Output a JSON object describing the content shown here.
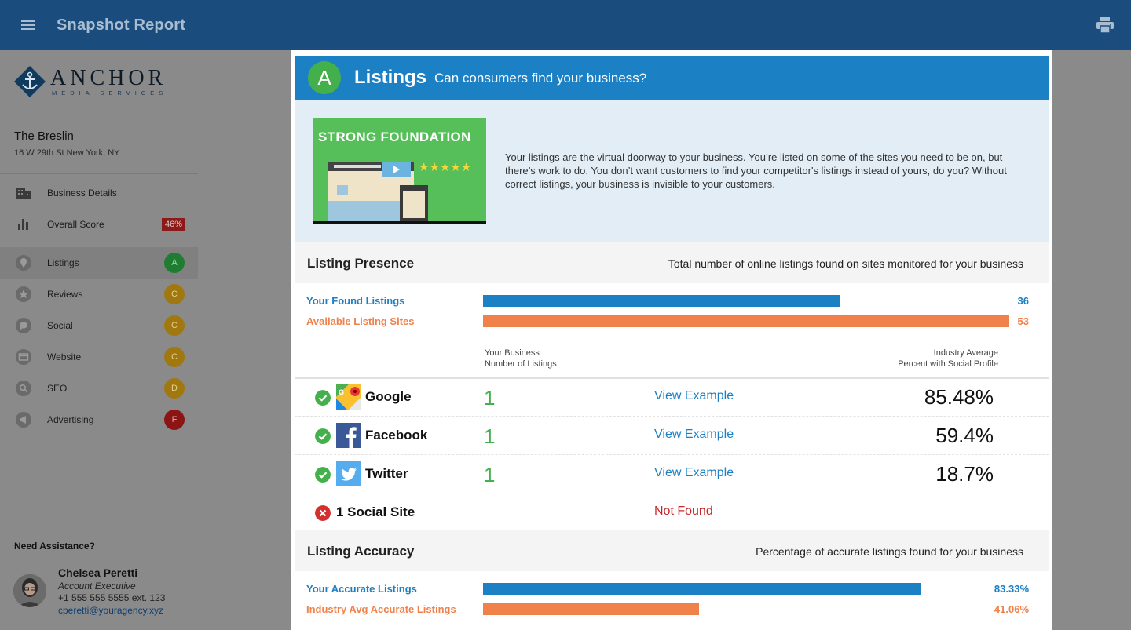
{
  "header": {
    "title": "Snapshot Report"
  },
  "sidebar": {
    "logo": {
      "name": "ANCHOR",
      "subtitle": "MEDIA SERVICES"
    },
    "business": {
      "name": "The Breslin",
      "address": "16 W 29th St New York, NY"
    },
    "top_items": [
      {
        "label": "Business Details",
        "icon": "building-icon"
      },
      {
        "label": "Overall Score",
        "icon": "bar-chart-icon",
        "badge": "46%"
      }
    ],
    "nav": [
      {
        "label": "Listings",
        "grade": "A",
        "icon": "map-pin-icon"
      },
      {
        "label": "Reviews",
        "grade": "C",
        "icon": "star-icon"
      },
      {
        "label": "Social",
        "grade": "C",
        "icon": "chat-bubble-icon"
      },
      {
        "label": "Website",
        "grade": "C",
        "icon": "browser-icon"
      },
      {
        "label": "SEO",
        "grade": "D",
        "icon": "search-icon"
      },
      {
        "label": "Advertising",
        "grade": "F",
        "icon": "megaphone-icon"
      }
    ],
    "assistance": {
      "title": "Need Assistance?",
      "name": "Chelsea Peretti",
      "role": "Account Executive",
      "phone": "+1 555 555 5555 ext. 123",
      "email": "cperetti@youragency.xyz"
    }
  },
  "card": {
    "grade": "A",
    "title": "Listings",
    "subtitle": "Can consumers find your business?",
    "promo_text": "STRONG FOUNDATION",
    "intro": "Your listings are the virtual doorway to your business. You’re listed on some of the sites you need to be on, but there’s work to do. You don’t want customers to find your competitor's listings instead of yours, do you? Without correct listings, your business is invisible to your customers."
  },
  "presence": {
    "title": "Listing Presence",
    "description": "Total number of online listings found on sites monitored for your business",
    "bars": [
      {
        "label": "Your Found Listings",
        "value": 36,
        "display": "36",
        "max": 53
      },
      {
        "label": "Available Listing Sites",
        "value": 53,
        "display": "53",
        "max": 53
      }
    ],
    "col_business": [
      "Your Business",
      "Number of Listings"
    ],
    "col_industry": [
      "Industry Average",
      "Percent with Social Profile"
    ],
    "rows": [
      {
        "name": "Google",
        "count": "1",
        "link": "View Example",
        "pct": "85.48%",
        "icon": "google-maps-icon"
      },
      {
        "name": "Facebook",
        "count": "1",
        "link": "View Example",
        "pct": "59.4%",
        "icon": "facebook-icon"
      },
      {
        "name": "Twitter",
        "count": "1",
        "link": "View Example",
        "pct": "18.7%",
        "icon": "twitter-icon"
      }
    ],
    "missing": {
      "name": "1 Social Site",
      "status": "Not Found"
    }
  },
  "accuracy": {
    "title": "Listing Accuracy",
    "description": "Percentage of accurate listings found for your business",
    "bars": [
      {
        "label": "Your Accurate Listings",
        "percent": 83.33,
        "display": "83.33%"
      },
      {
        "label": "Industry Avg Accurate Listings",
        "percent": 41.06,
        "display": "41.06%"
      }
    ]
  },
  "colors": {
    "topbar": "#1a4d7e",
    "header_blue": "#1b80c4",
    "grade_green": "#44b04b",
    "orange": "#f0814a",
    "error_red": "#c62828"
  }
}
